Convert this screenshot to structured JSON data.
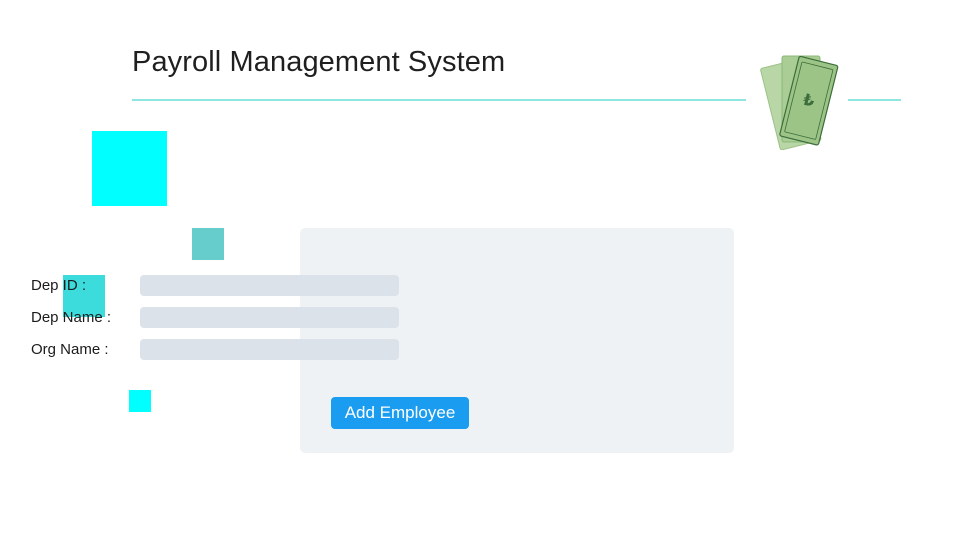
{
  "header": {
    "title": "Payroll Management System",
    "icon": "money-bills-icon",
    "accent_color": "#8fe6e0"
  },
  "form": {
    "fields": [
      {
        "label": "Dep ID :",
        "value": "",
        "placeholder": ""
      },
      {
        "label": "Dep Name :",
        "value": "",
        "placeholder": ""
      },
      {
        "label": "Org Name :",
        "value": "",
        "placeholder": ""
      }
    ],
    "submit_label": "Add Employee",
    "button_color": "#1a9cf0",
    "card_color": "#eff2f5"
  },
  "decorations": {
    "square_colors": [
      "#00ffff",
      "#66cccc",
      "#3cdcdc",
      "#00ffff"
    ]
  }
}
